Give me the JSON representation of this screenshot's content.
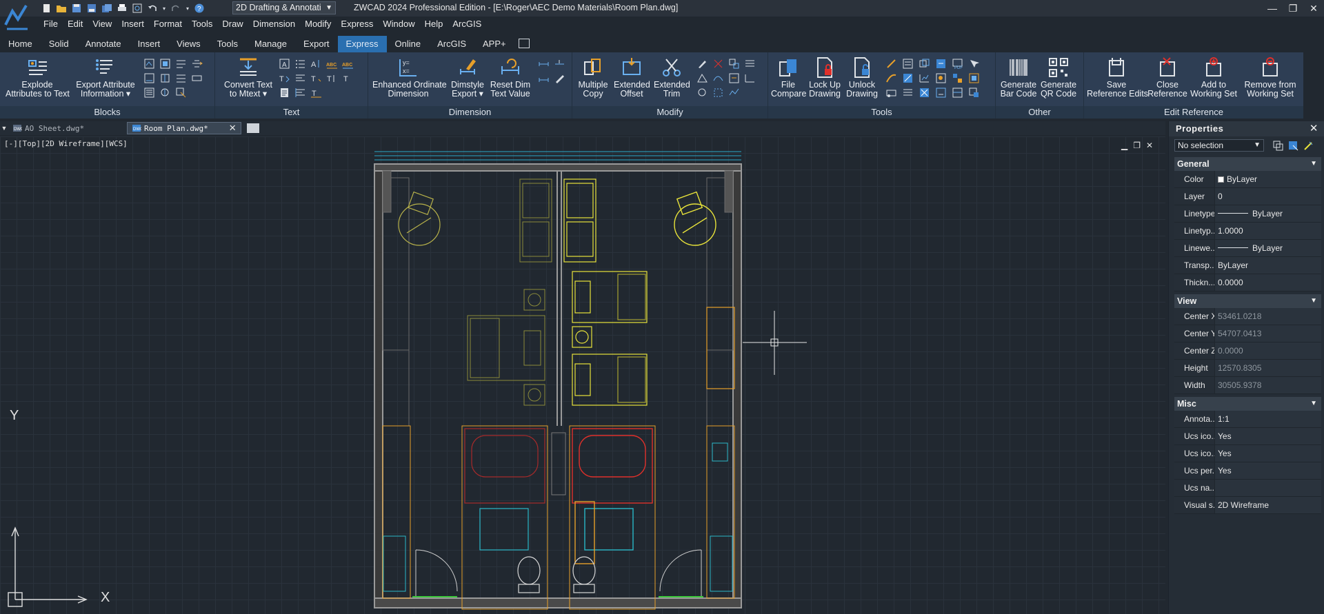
{
  "title_bar": {
    "workspace": "2D Drafting & Annotati",
    "title": "ZWCAD 2024 Professional Edition - [E:\\Roger\\AEC Demo Materials\\Room Plan.dwg]"
  },
  "menu": [
    "File",
    "Edit",
    "View",
    "Insert",
    "Format",
    "Tools",
    "Draw",
    "Dimension",
    "Modify",
    "Express",
    "Window",
    "Help",
    "ArcGIS"
  ],
  "ribbon_tabs": [
    "Home",
    "Solid",
    "Annotate",
    "Insert",
    "Views",
    "Tools",
    "Manage",
    "Export",
    "Express",
    "Online",
    "ArcGIS",
    "APP+"
  ],
  "active_tab": "Express",
  "ribbon": {
    "blocks": {
      "label": "Blocks",
      "explode_l1": "Explode",
      "explode_l2": "Attributes to Text",
      "export_l1": "Export Attribute",
      "export_l2": "Information ▾"
    },
    "text": {
      "label": "Text",
      "convert_l1": "Convert Text",
      "convert_l2": "to Mtext ▾"
    },
    "dimension": {
      "label": "Dimension",
      "eod_l1": "Enhanced Ordinate",
      "eod_l2": "Dimension",
      "dimstyle_l1": "Dimstyle",
      "dimstyle_l2": "Export ▾",
      "reset_l1": "Reset Dim",
      "reset_l2": "Text Value"
    },
    "modify": {
      "label": "Modify",
      "mc_l1": "Multiple",
      "mc_l2": "Copy",
      "eo_l1": "Extended",
      "eo_l2": "Offset",
      "et_l1": "Extended",
      "et_l2": "Trim"
    },
    "tools": {
      "label": "Tools",
      "fc_l1": "File",
      "fc_l2": "Compare",
      "lock_l1": "Lock Up",
      "lock_l2": "Drawing",
      "unlock_l1": "Unlock",
      "unlock_l2": "Drawing"
    },
    "other": {
      "label": "Other",
      "bar_l1": "Generate",
      "bar_l2": "Bar Code",
      "qr_l1": "Generate",
      "qr_l2": "QR Code"
    },
    "editref": {
      "label": "Edit Reference",
      "save_l1": "Save",
      "save_l2": "Reference Edits",
      "close_l1": "Close",
      "close_l2": "Reference",
      "add_l1": "Add to",
      "add_l2": "Working Set",
      "remove_l1": "Remove from",
      "remove_l2": "Working Set"
    }
  },
  "doc_tabs": [
    {
      "name": "AO Sheet.dwg*"
    },
    {
      "name": "Room Plan.dwg*"
    }
  ],
  "viewport_label": "[-][Top][2D Wireframe][WCS]",
  "axis": {
    "x": "X",
    "y": "Y"
  },
  "properties": {
    "title": "Properties",
    "selection": "No selection",
    "general": {
      "label": "General",
      "rows": [
        {
          "key": "Color",
          "value": "ByLayer"
        },
        {
          "key": "Layer",
          "value": "0"
        },
        {
          "key": "Linetype",
          "value": "ByLayer"
        },
        {
          "key": "Linetyp...",
          "value": "1.0000"
        },
        {
          "key": "Linewe...",
          "value": "ByLayer"
        },
        {
          "key": "Transp...",
          "value": "ByLayer"
        },
        {
          "key": "Thickn...",
          "value": "0.0000"
        }
      ]
    },
    "view": {
      "label": "View",
      "rows": [
        {
          "key": "Center X",
          "value": "53461.0218"
        },
        {
          "key": "Center Y",
          "value": "54707.0413"
        },
        {
          "key": "Center Z",
          "value": "0.0000"
        },
        {
          "key": "Height",
          "value": "12570.8305"
        },
        {
          "key": "Width",
          "value": "30505.9378"
        }
      ]
    },
    "misc": {
      "label": "Misc",
      "rows": [
        {
          "key": "Annota...",
          "value": "1:1"
        },
        {
          "key": "Ucs ico...",
          "value": "Yes"
        },
        {
          "key": "Ucs ico...",
          "value": "Yes"
        },
        {
          "key": "Ucs per...",
          "value": "Yes"
        },
        {
          "key": "Ucs na...",
          "value": ""
        },
        {
          "key": "Visual s...",
          "value": "2D Wireframe"
        }
      ]
    }
  },
  "colors": {
    "ribbon": "#2e3e54",
    "active_tab": "#2a6fb0",
    "canvas": "#212830",
    "yellow": "#e8e33a",
    "red": "#e0302a",
    "orange": "#e8a02a",
    "cyan": "#2ab8c8"
  }
}
